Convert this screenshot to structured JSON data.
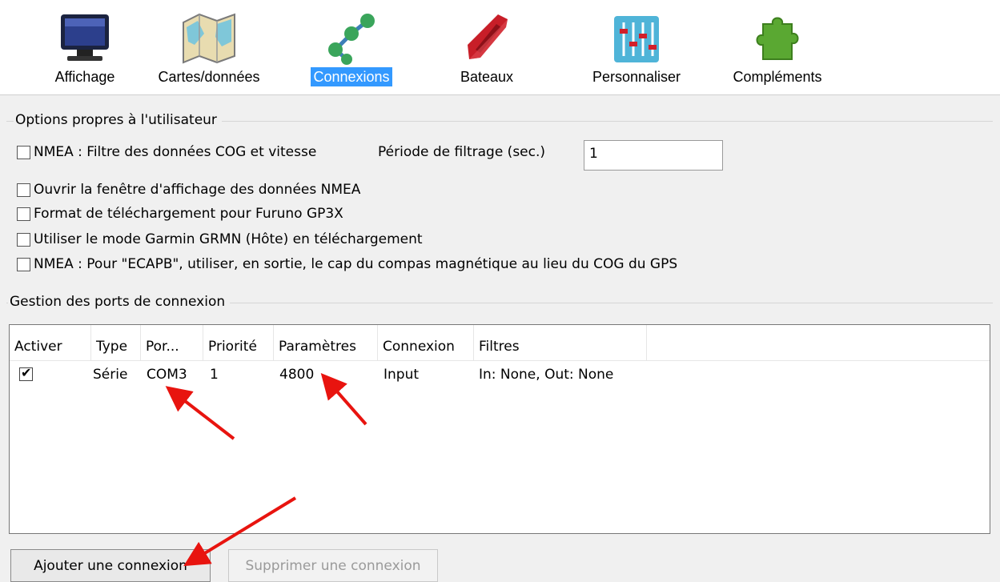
{
  "toolbar": {
    "items": [
      {
        "label": "Affichage",
        "icon": "monitor-icon"
      },
      {
        "label": "Cartes/données",
        "icon": "chart-map-icon"
      },
      {
        "label": "Connexions",
        "icon": "connections-icon",
        "selected": true
      },
      {
        "label": "Bateaux",
        "icon": "boat-icon"
      },
      {
        "label": "Personnaliser",
        "icon": "sliders-icon"
      },
      {
        "label": "Compléments",
        "icon": "puzzle-icon"
      }
    ]
  },
  "user_options": {
    "title": "Options propres à l'utilisateur",
    "nmea_filter_label": "NMEA : Filtre des données COG et vitesse",
    "nmea_filter_checked": false,
    "filter_period_label": "Période de filtrage (sec.)",
    "filter_period_value": "1",
    "checkboxes": [
      {
        "label": "Ouvrir la fenêtre d'affichage des données NMEA",
        "checked": false
      },
      {
        "label": "Format de téléchargement pour Furuno GP3X",
        "checked": false
      },
      {
        "label": "Utiliser le mode Garmin GRMN (Hôte) en téléchargement",
        "checked": false
      },
      {
        "label": "NMEA : Pour \"ECAPB\", utiliser, en sortie, le cap du compas magnétique  au lieu du COG du GPS",
        "checked": false
      }
    ]
  },
  "ports": {
    "title": "Gestion des ports de connexion",
    "columns": [
      "Activer",
      "Type",
      "Por...",
      "Priorité",
      "Paramètres",
      "Connexion",
      "Filtres"
    ],
    "rows": [
      {
        "active": true,
        "type": "Série",
        "port": "COM3",
        "priority": "1",
        "params": "4800",
        "connection": "Input",
        "filters": "In: None, Out: None"
      }
    ]
  },
  "buttons": {
    "add": "Ajouter une connexion",
    "remove": "Supprimer une connexion"
  },
  "colors": {
    "selected_tab": "#3399ff",
    "annotation_arrow": "#e8140f"
  }
}
